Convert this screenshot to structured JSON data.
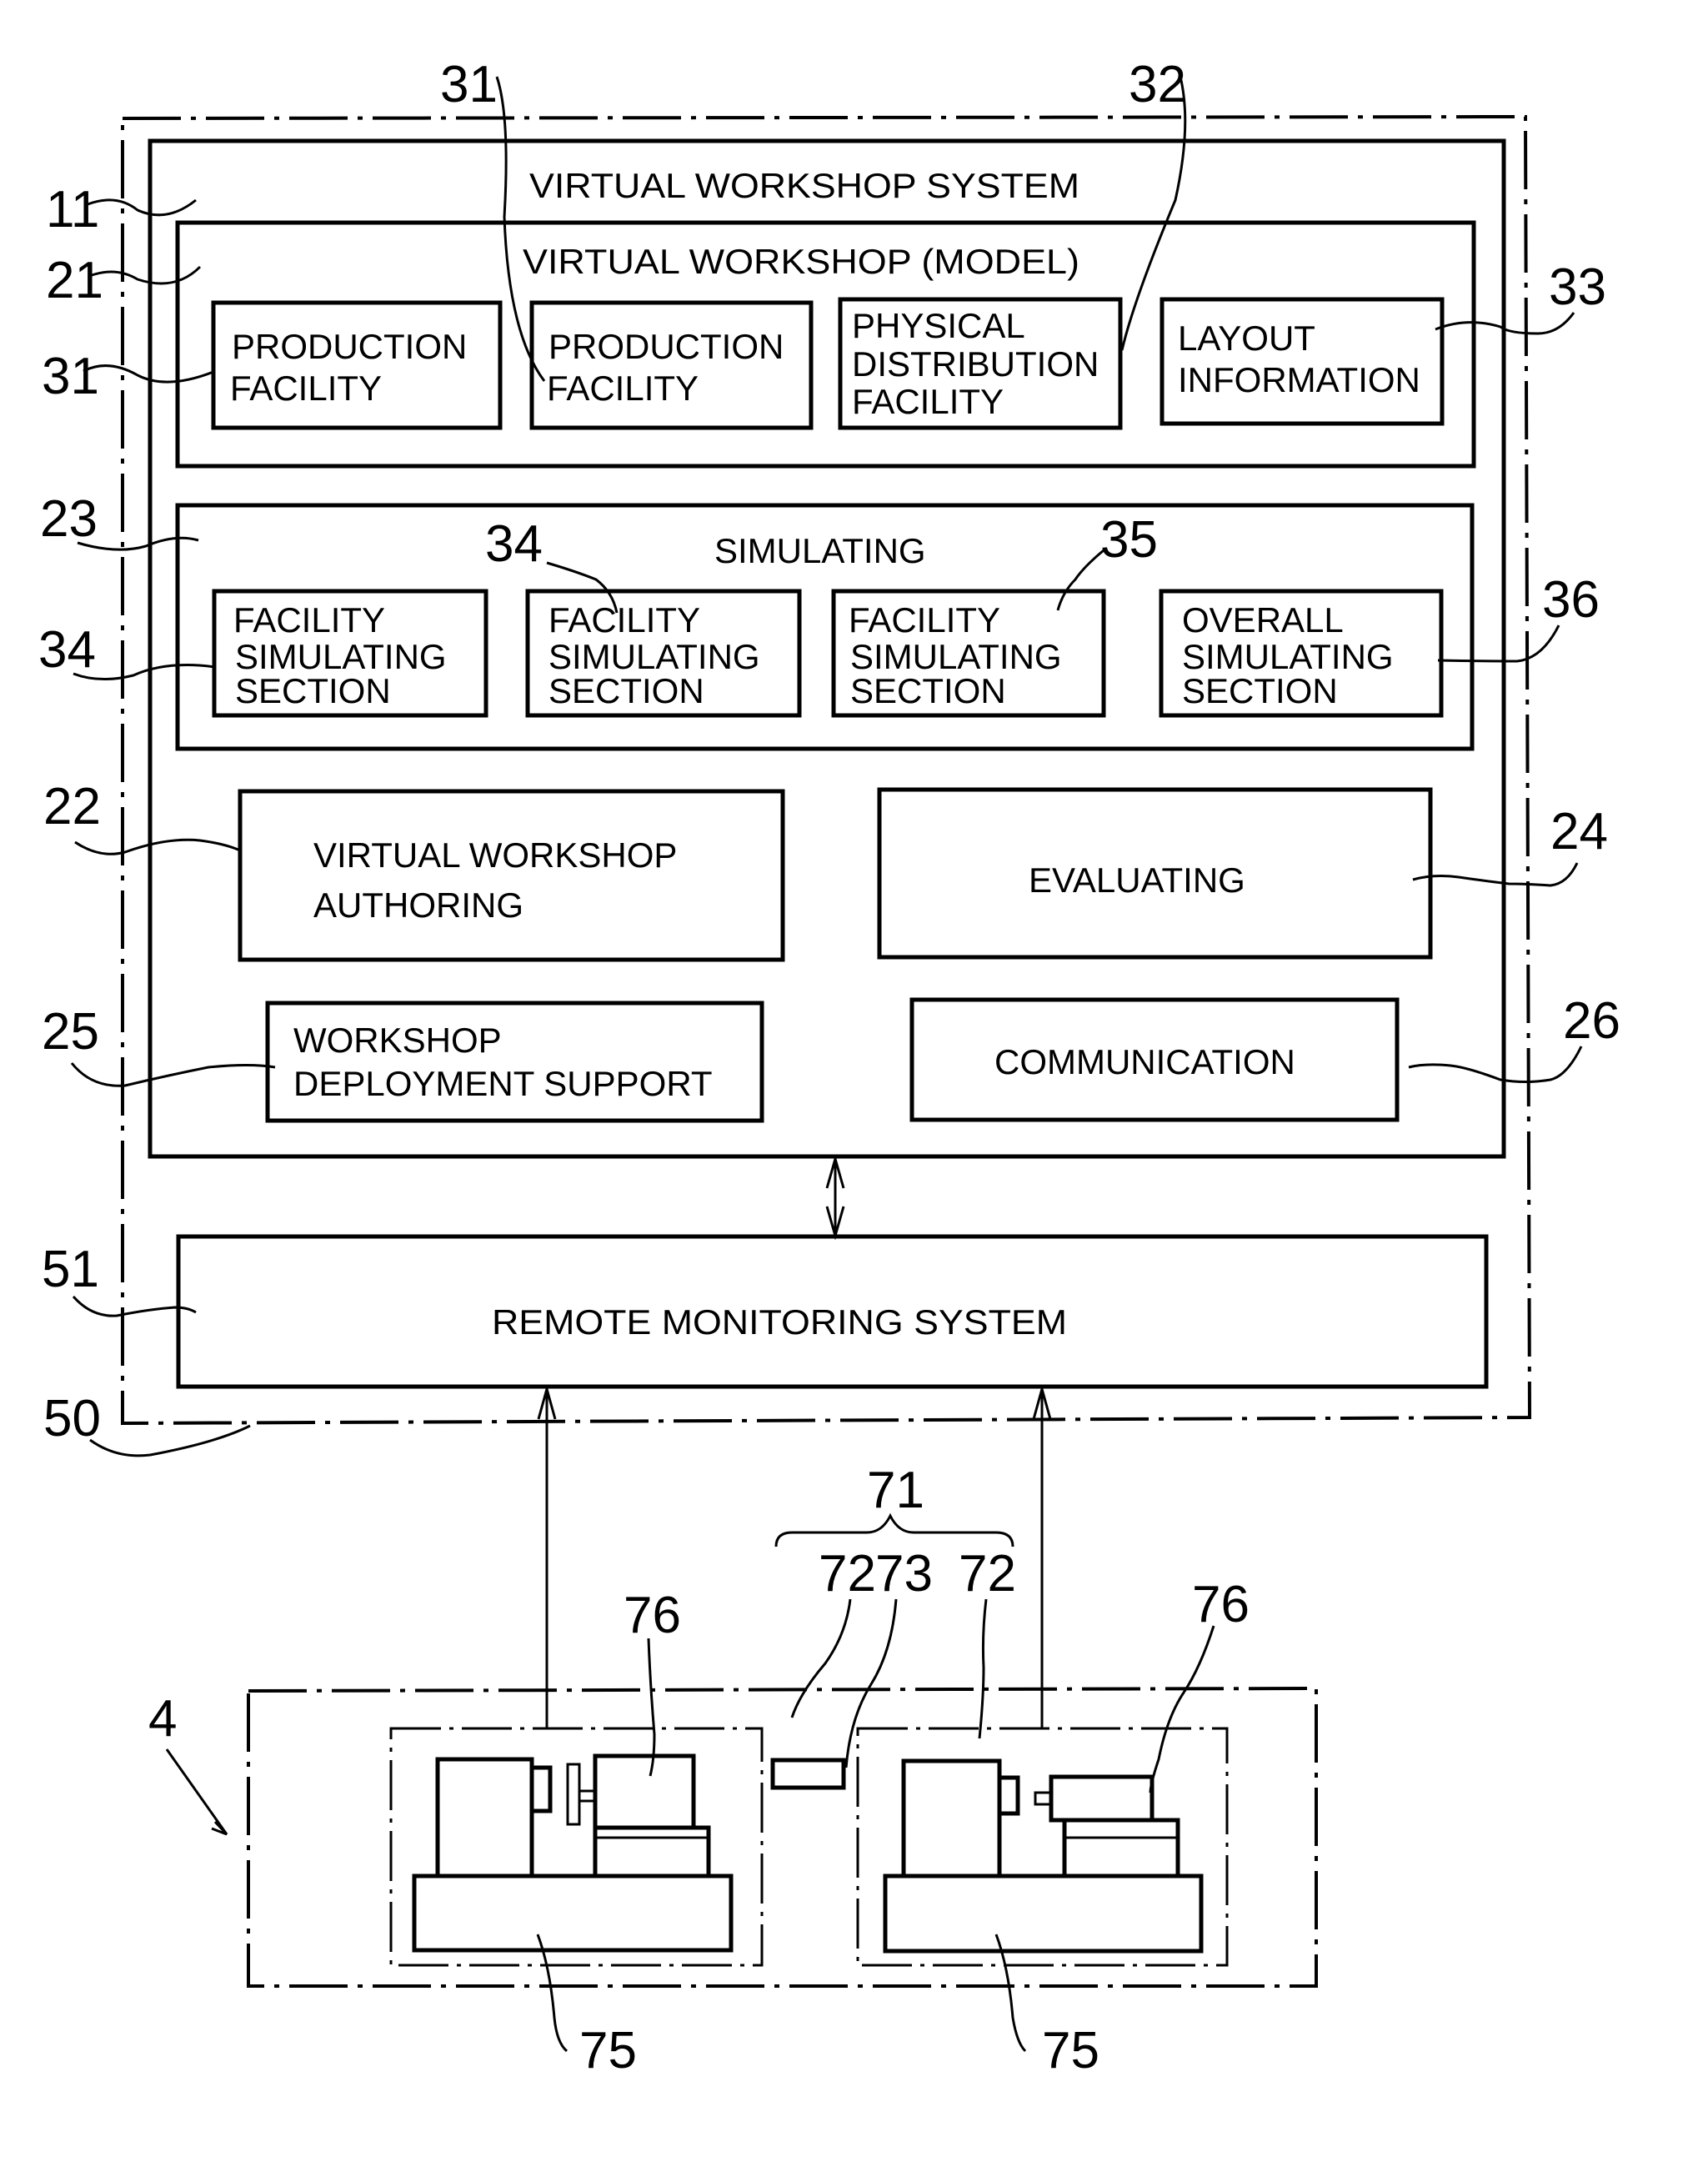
{
  "figure": {
    "system_label": "VIRTUAL WORKSHOP SYSTEM",
    "model_label": "VIRTUAL WORKSHOP (MODEL)",
    "model_items": [
      {
        "lines": [
          "PRODUCTION",
          "FACILITY"
        ],
        "ref": "31"
      },
      {
        "lines": [
          "PRODUCTION",
          "FACILITY"
        ],
        "ref": "31"
      },
      {
        "lines": [
          "PHYSICAL",
          "DISTRIBUTION",
          "FACILITY"
        ],
        "ref": "32"
      },
      {
        "lines": [
          "LAYOUT",
          "INFORMATION"
        ],
        "ref": "33"
      }
    ],
    "simulating_label": "SIMULATING",
    "simulating_items": [
      {
        "lines": [
          "FACILITY",
          "SIMULATING",
          "SECTION"
        ],
        "ref": "34"
      },
      {
        "lines": [
          "FACILITY",
          "SIMULATING",
          "SECTION"
        ],
        "ref": "34"
      },
      {
        "lines": [
          "FACILITY",
          "SIMULATING",
          "SECTION"
        ],
        "ref": "35"
      },
      {
        "lines": [
          "OVERALL",
          "SIMULATING",
          "SECTION"
        ],
        "ref": "36"
      }
    ],
    "authoring": {
      "lines": [
        "VIRTUAL WORKSHOP",
        "AUTHORING"
      ],
      "ref": "22"
    },
    "evaluating": {
      "lines": [
        "EVALUATING"
      ],
      "ref": "24"
    },
    "deployment": {
      "lines": [
        "WORKSHOP",
        "DEPLOYMENT SUPPORT"
      ],
      "ref": "25"
    },
    "communication": {
      "lines": [
        "COMMUNICATION"
      ],
      "ref": "26"
    },
    "remote": {
      "lines": [
        "REMOTE MONITORING SYSTEM"
      ],
      "ref": "51"
    },
    "refs": {
      "system": "11",
      "model": "21",
      "simulating": "23",
      "outer": "50",
      "workshop": "4",
      "group": "71",
      "machine_area_left": "72",
      "connector": "73",
      "machine_area_right": "72",
      "spindle_left": "76",
      "spindle_right": "76",
      "bed_left": "75",
      "bed_right": "75",
      "top_31": "31",
      "top_32": "32",
      "sim_34": "34",
      "sim_35": "35"
    }
  }
}
